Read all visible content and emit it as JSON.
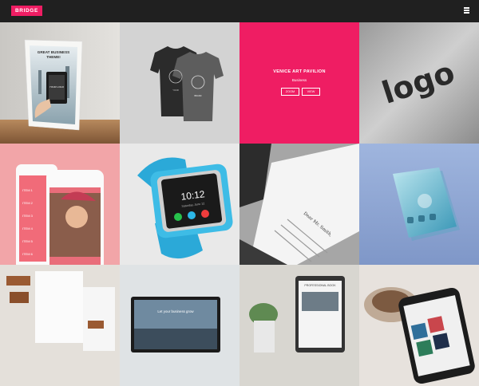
{
  "header": {
    "logo_text": "BRIDGE",
    "menu_icon": "hamburger-icon"
  },
  "colors": {
    "accent": "#ef1d63",
    "topbar": "#202020"
  },
  "featured": {
    "title": "VENICE ART PAVILION",
    "category": "Business",
    "zoom_label": "ZOOM",
    "view_label": "VIEW"
  },
  "tiles": {
    "poster": {
      "headline_1": "GREAT BUSINESS",
      "headline_2": "THEME!",
      "badge": "YOUR LOGO"
    },
    "tshirts": {
      "print_1": "YOUR",
      "print_2": "BRAND"
    },
    "logo_3d": {
      "text": "logo"
    },
    "phones": {
      "menu": [
        "ITEM 1",
        "ITEM 2",
        "ITEM 3",
        "ITEM 4",
        "ITEM 5",
        "ITEM 6"
      ]
    },
    "watch": {
      "time": "10:12",
      "date": "Saturday, June 12"
    },
    "letter": {
      "salutation": "Dear Mr. Smith,"
    },
    "laptop": {
      "headline": "Let your business grow"
    },
    "tablet": {
      "title": "PROFESSIONAL BOOK"
    }
  }
}
